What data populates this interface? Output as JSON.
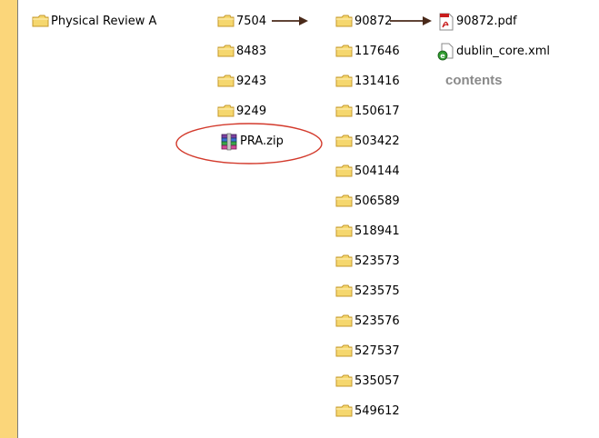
{
  "colors": {
    "background": "#fbd67a",
    "panel": "#ffffff",
    "folder_fill": "#f5d76e",
    "folder_stroke": "#c59a2c",
    "arrow": "#4a2a1a",
    "highlight_oval": "#d33a2c",
    "caption": "#8a8a8a"
  },
  "root": {
    "label": "Physical Review A",
    "icon": "folder-icon"
  },
  "level1": [
    {
      "label": "7504",
      "icon": "folder-icon"
    },
    {
      "label": "8483",
      "icon": "folder-icon"
    },
    {
      "label": "9243",
      "icon": "folder-icon"
    },
    {
      "label": "9249",
      "icon": "folder-icon"
    },
    {
      "label": "PRA.zip",
      "icon": "zip-archive-icon"
    }
  ],
  "level2": [
    "90872",
    "117646",
    "131416",
    "150617",
    "503422",
    "504144",
    "506589",
    "518941",
    "523573",
    "523575",
    "523576",
    "527537",
    "535057",
    "549612"
  ],
  "files": [
    {
      "label": "90872.pdf",
      "icon": "pdf-icon"
    },
    {
      "label": "dublin_core.xml",
      "icon": "xml-file-icon"
    }
  ],
  "caption": "contents"
}
